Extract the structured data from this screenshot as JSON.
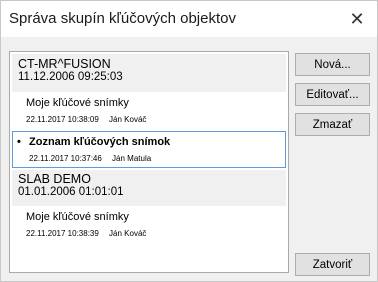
{
  "window": {
    "title": "Správa skupín kľúčových objektov",
    "close_glyph": "✕"
  },
  "groups": [
    {
      "name": "CT-MR^FUSION",
      "date": "11.12.2006 09:25:03",
      "items": [
        {
          "name": "Moje kľúčové snímky",
          "datetime": "22.11.2017 10:38:09",
          "user": "Ján Kováč",
          "selected": false
        },
        {
          "name": "Zoznam kľúčových snímok",
          "datetime": "22.11.2017 10:37:46",
          "user": "Ján Matula",
          "selected": true
        }
      ]
    },
    {
      "name": "SLAB DEMO",
      "date": "01.01.2006 01:01:01",
      "items": [
        {
          "name": "Moje kľúčové snímky",
          "datetime": "22.11.2017 10:38:39",
          "user": "Ján Kováč",
          "selected": false
        }
      ]
    }
  ],
  "selected_bullet": "•",
  "buttons": {
    "new": "Nová...",
    "edit": "Editovať...",
    "delete": "Zmazať",
    "close": "Zatvoriť"
  },
  "colors": {
    "selection_border": "#5d9bdc",
    "group_header_bg": "#f0f0f0",
    "button_bg": "#e1e1e1"
  }
}
